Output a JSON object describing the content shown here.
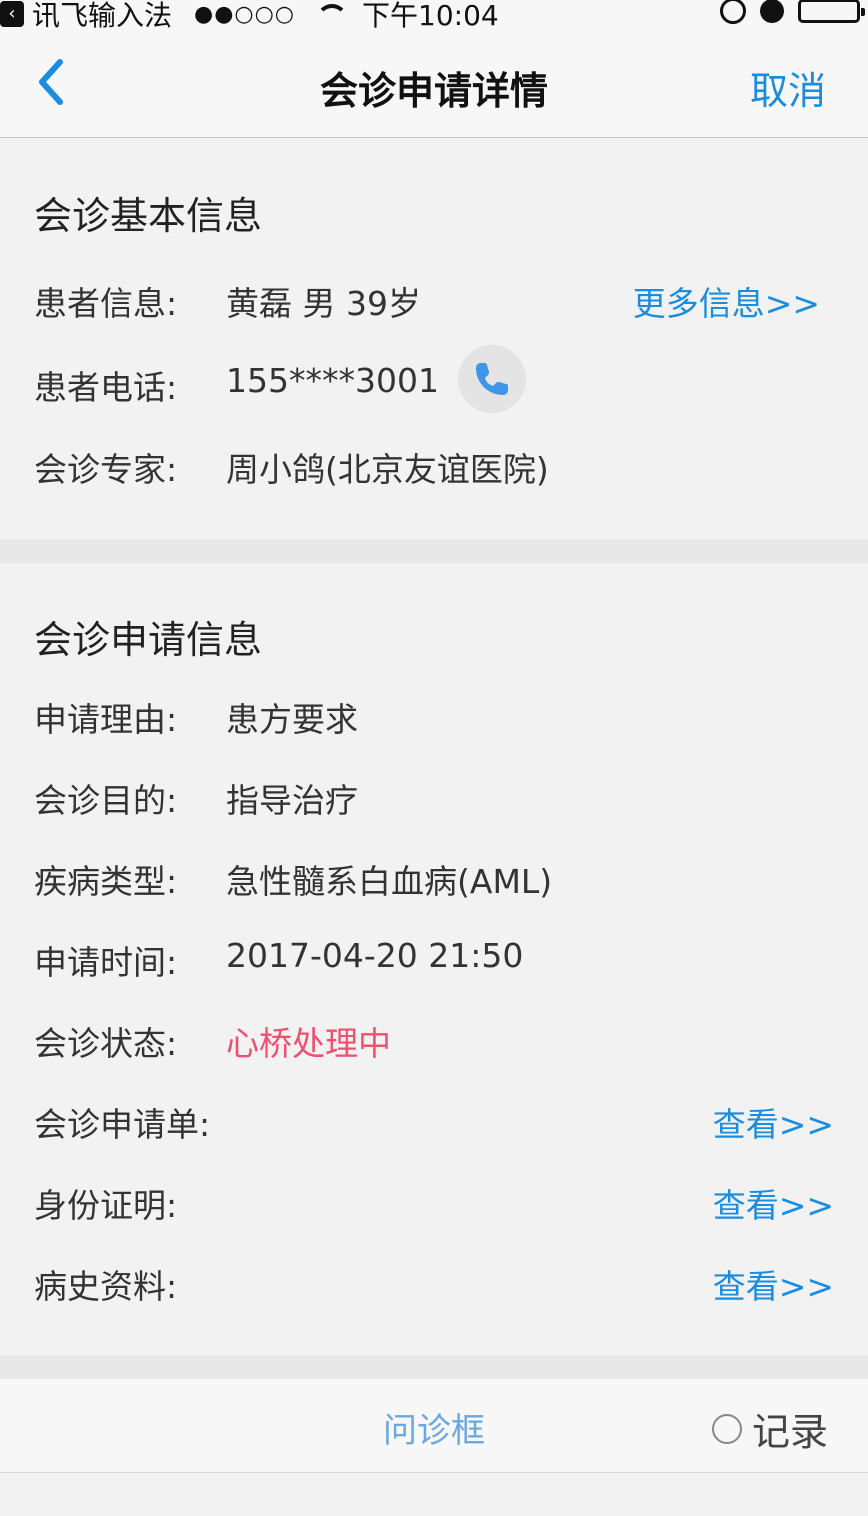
{
  "status_bar": {
    "carrier": "讯飞输入法",
    "signal": "●●○○○",
    "time": "下午10:04"
  },
  "nav": {
    "title": "会诊申请详情",
    "cancel_label": "取消"
  },
  "basic_info": {
    "title": "会诊基本信息",
    "patient_label": "患者信息:",
    "patient_value": "黄磊  男  39岁",
    "more_link": "更多信息>>",
    "phone_label": "患者电话:",
    "phone_value": "155****3001",
    "expert_label": "会诊专家:",
    "expert_value": "周小鸽(北京友谊医院)"
  },
  "request_info": {
    "title": "会诊申请信息",
    "reason_label": "申请理由:",
    "reason_value": "患方要求",
    "purpose_label": "会诊目的:",
    "purpose_value": "指导治疗",
    "disease_label": "疾病类型:",
    "disease_value": "急性髓系白血病(AML)",
    "time_label": "申请时间:",
    "time_value": "2017-04-20 21:50",
    "status_label": "会诊状态:",
    "status_value": "心桥处理中",
    "form_label": "会诊申请单:",
    "id_label": "身份证明:",
    "history_label": "病史资料:",
    "view_link": "查看>>"
  },
  "bottom_bar": {
    "consult_box": "问诊框",
    "record_label": "记录"
  },
  "colors": {
    "accent": "#1a8de0",
    "status": "#f0506e",
    "background": "#f2f2f2"
  }
}
